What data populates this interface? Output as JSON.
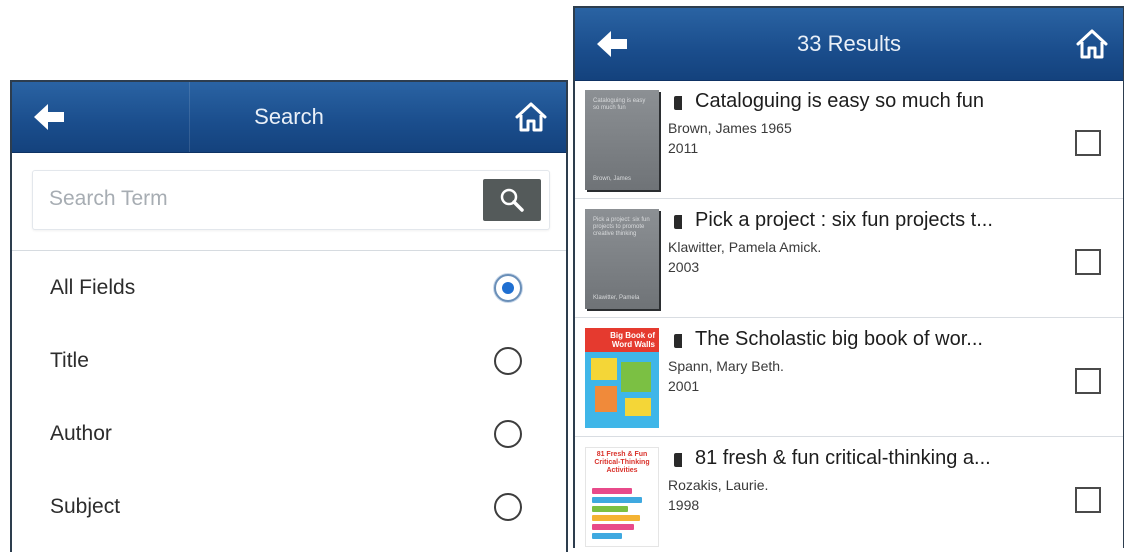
{
  "colors": {
    "header_blue": "#1a4d8c",
    "radio_selected": "#1f6fd1",
    "search_button": "#545a5a"
  },
  "search_screen": {
    "title": "Search",
    "back_icon": "arrow-left-icon",
    "home_icon": "home-icon",
    "search_placeholder": "Search Term",
    "search_value": "",
    "search_button_icon": "search-icon",
    "options": [
      {
        "label": "All Fields",
        "selected": true
      },
      {
        "label": "Title",
        "selected": false
      },
      {
        "label": "Author",
        "selected": false
      },
      {
        "label": "Subject",
        "selected": false
      }
    ]
  },
  "results_screen": {
    "title": "33 Results",
    "back_icon": "arrow-left-icon",
    "home_icon": "home-icon",
    "items": [
      {
        "title": "Cataloguing is easy so much fun",
        "author": "Brown, James 1965",
        "year": "2011",
        "cover_text": "Cataloguing is easy so much fun",
        "cover_author": "Brown, James",
        "checked": false
      },
      {
        "title": "Pick a project : six fun projects t...",
        "author": "Klawitter, Pamela Amick.",
        "year": "2003",
        "cover_text": "Pick a project: six fun projects to promote creative thinking",
        "cover_author": "Klawitter, Pamela",
        "checked": false
      },
      {
        "title": "The Scholastic big book of wor...",
        "author": "Spann, Mary Beth.",
        "year": "2001",
        "cover_text": "Big Book of Word Walls",
        "checked": false
      },
      {
        "title": "81 fresh & fun critical-thinking a...",
        "author": "Rozakis, Laurie.",
        "year": "1998",
        "cover_text": "81 Fresh & Fun Critical-Thinking Activities",
        "checked": false
      }
    ]
  }
}
